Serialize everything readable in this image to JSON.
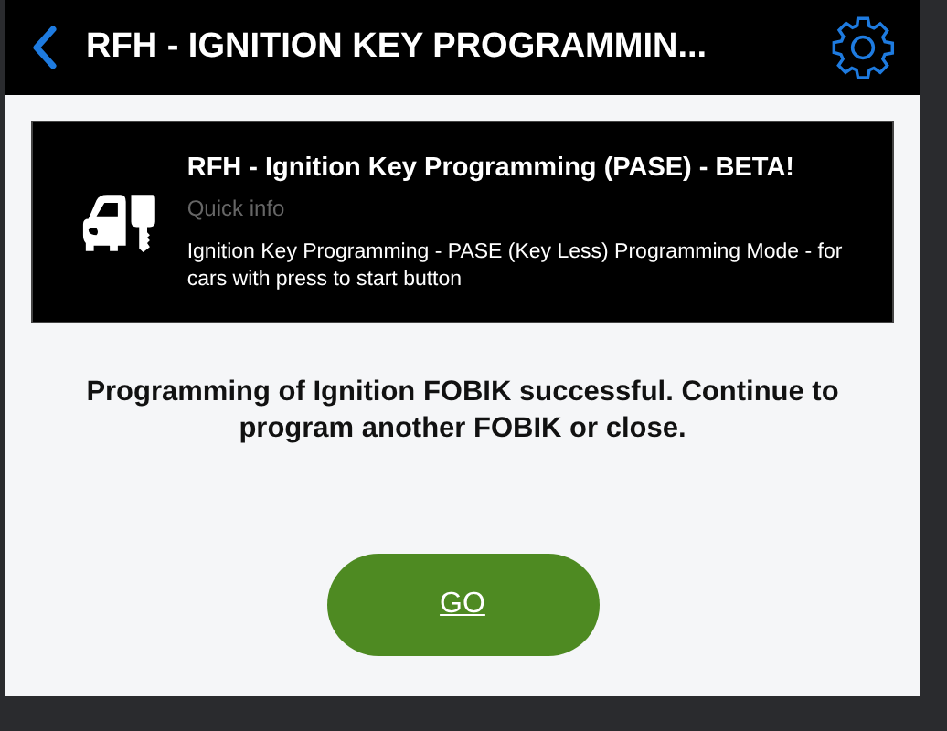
{
  "header": {
    "title": "RFH - IGNITION KEY PROGRAMMIN..."
  },
  "info_card": {
    "title": "RFH - Ignition Key Programming (PASE) - BETA!",
    "subtitle": "Quick info",
    "description": "Ignition Key Programming - PASE (Key Less) Programming Mode - for cars with press to start button"
  },
  "message": "Programming of Ignition FOBIK successful. Continue to program another FOBIK or close.",
  "buttons": [
    {
      "label": "GO"
    }
  ]
}
